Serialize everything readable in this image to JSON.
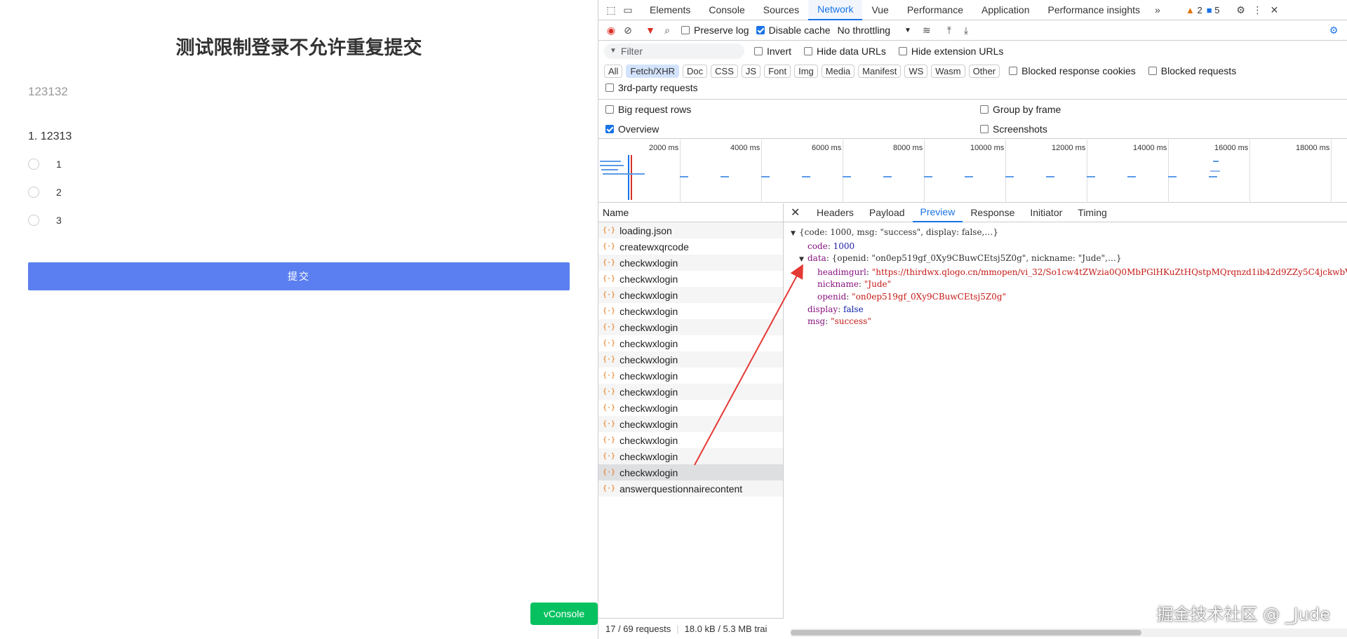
{
  "page": {
    "title": "测试限制登录不允许重复提交",
    "subtitle": "123132",
    "question": "1. 12313",
    "options": [
      "1",
      "2",
      "3"
    ],
    "submit_label": "提交",
    "vconsole_label": "vConsole"
  },
  "devtools": {
    "tabs": [
      "Elements",
      "Console",
      "Sources",
      "Network",
      "Vue",
      "Performance",
      "Application",
      "Performance insights"
    ],
    "active_tab": "Network",
    "warnings_count": "2",
    "messages_count": "5",
    "toolbar": {
      "preserve_log": "Preserve log",
      "disable_cache": "Disable cache",
      "throttling": "No throttling"
    },
    "filter": {
      "placeholder": "Filter",
      "invert": "Invert",
      "hide_data_urls": "Hide data URLs",
      "hide_extension_urls": "Hide extension URLs"
    },
    "types": [
      "All",
      "Fetch/XHR",
      "Doc",
      "CSS",
      "JS",
      "Font",
      "Img",
      "Media",
      "Manifest",
      "WS",
      "Wasm",
      "Other"
    ],
    "active_type": "Fetch/XHR",
    "blocked_response_cookies": "Blocked response cookies",
    "blocked_requests": "Blocked requests",
    "third_party": "3rd-party requests",
    "big_request_rows": "Big request rows",
    "group_by_frame": "Group by frame",
    "overview": "Overview",
    "screenshots": "Screenshots",
    "timeline_ticks": [
      "2000 ms",
      "4000 ms",
      "6000 ms",
      "8000 ms",
      "10000 ms",
      "12000 ms",
      "14000 ms",
      "16000 ms",
      "18000 ms"
    ],
    "requests_header": "Name",
    "requests": [
      "loading.json",
      "createwxqrcode",
      "checkwxlogin",
      "checkwxlogin",
      "checkwxlogin",
      "checkwxlogin",
      "checkwxlogin",
      "checkwxlogin",
      "checkwxlogin",
      "checkwxlogin",
      "checkwxlogin",
      "checkwxlogin",
      "checkwxlogin",
      "checkwxlogin",
      "checkwxlogin",
      "checkwxlogin",
      "answerquestionnairecontent"
    ],
    "selected_request_index": 15,
    "status_requests": "17 / 69 requests",
    "status_size": "18.0 kB / 5.3 MB trai",
    "detail_tabs": [
      "Headers",
      "Payload",
      "Preview",
      "Response",
      "Initiator",
      "Timing"
    ],
    "active_detail_tab": "Preview",
    "preview": {
      "root_summary": "{code: 1000, msg: \"success\", display: false,…}",
      "code_key": "code",
      "code_val": "1000",
      "data_key": "data",
      "data_summary": "{openid: \"on0ep519gf_0Xy9CBuwCEtsj5Z0g\", nickname: \"Jude\",…}",
      "headimgurl_key": "headimgurl",
      "headimgurl_val": "\"https://thirdwx.qlogo.cn/mmopen/vi_32/So1cw4tZWzia0Q0MbPGlHKuZtHQstpMQrqnzd1ib42d9ZZy5C4jckwbV",
      "nickname_key": "nickname",
      "nickname_val": "\"Jude\"",
      "openid_key": "openid",
      "openid_val": "\"on0ep519gf_0Xy9CBuwCEtsj5Z0g\"",
      "display_key": "display",
      "display_val": "false",
      "msg_key": "msg",
      "msg_val": "\"success\""
    }
  },
  "watermark": "掘金技术社区 @ _Jude"
}
